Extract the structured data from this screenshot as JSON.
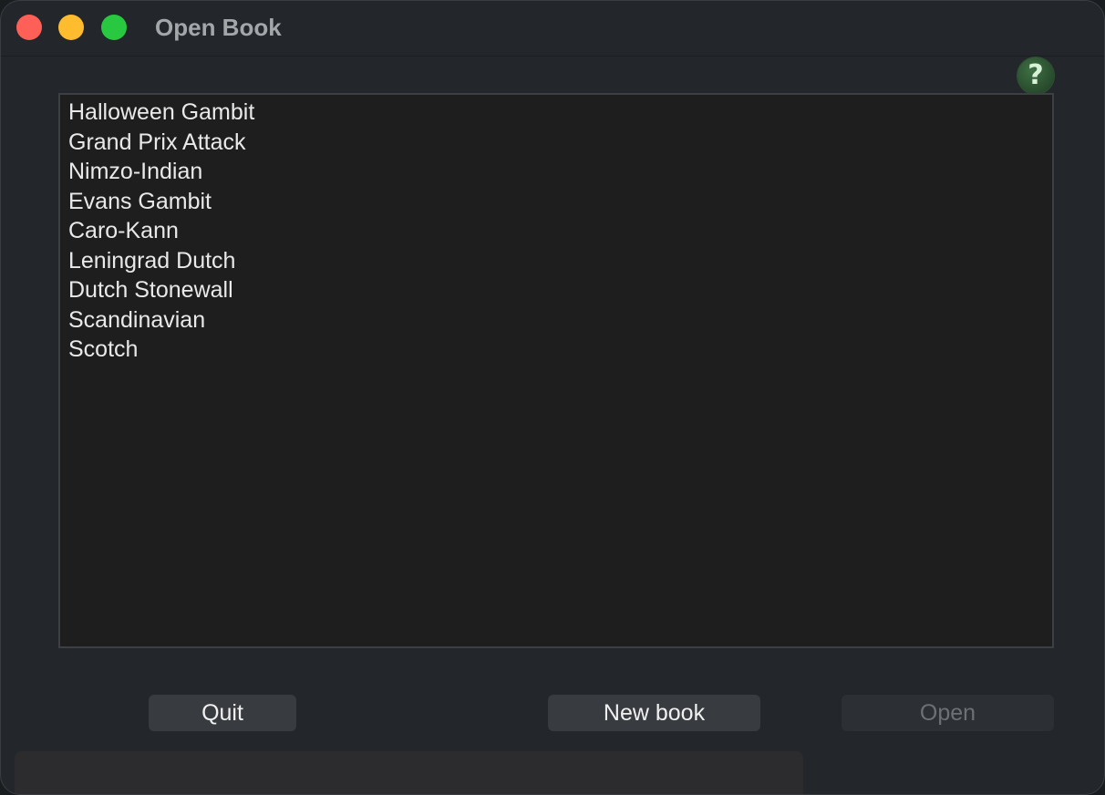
{
  "window": {
    "title": "Open Book"
  },
  "help": {
    "label": "?"
  },
  "books": [
    "Halloween Gambit",
    "Grand Prix Attack",
    "Nimzo-Indian",
    "Evans Gambit",
    "Caro-Kann",
    "Leningrad Dutch",
    "Dutch Stonewall",
    "Scandinavian",
    "Scotch"
  ],
  "buttons": {
    "quit": "Quit",
    "new_book": "New book",
    "open": "Open"
  },
  "status_bar": {
    "text": ""
  },
  "colors": {
    "close": "#fe5f57",
    "minimize": "#febc2e",
    "zoom": "#28c840",
    "help_badge": "#2e5a33",
    "list_background": "#1e1e1e",
    "window_background": "#23272b"
  }
}
